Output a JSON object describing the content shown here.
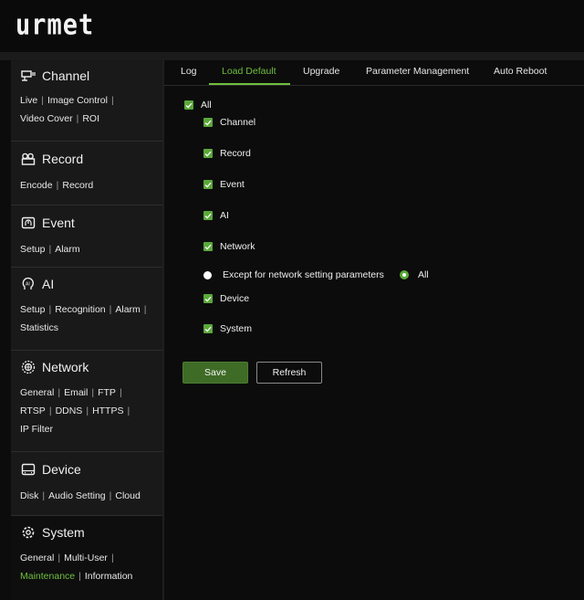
{
  "header": {
    "logo_text": "urmet"
  },
  "sidebar": {
    "sections": [
      {
        "title": "Channel",
        "icon": "channel-icon",
        "links": [
          [
            "Live",
            "Image Control"
          ],
          [
            "Video Cover",
            "ROI"
          ]
        ]
      },
      {
        "title": "Record",
        "icon": "record-icon",
        "links": [
          [
            "Encode",
            "Record"
          ]
        ]
      },
      {
        "title": "Event",
        "icon": "event-icon",
        "links": [
          [
            "Setup",
            "Alarm"
          ]
        ]
      },
      {
        "title": "AI",
        "icon": "ai-icon",
        "links": [
          [
            "Setup",
            "Recognition",
            "Alarm"
          ],
          [
            "Statistics"
          ]
        ]
      },
      {
        "title": "Network",
        "icon": "network-icon",
        "links": [
          [
            "General",
            "Email",
            "FTP"
          ],
          [
            "RTSP",
            "DDNS",
            "HTTPS"
          ],
          [
            "IP Filter"
          ]
        ]
      },
      {
        "title": "Device",
        "icon": "device-icon",
        "links": [
          [
            "Disk",
            "Audio Setting",
            "Cloud"
          ]
        ]
      },
      {
        "title": "System",
        "icon": "system-icon",
        "links": [
          [
            "General",
            "Multi-User"
          ],
          [
            "Maintenance",
            "Information"
          ]
        ]
      }
    ],
    "selected_link": "Maintenance"
  },
  "tabs": [
    "Log",
    "Load Default",
    "Upgrade",
    "Parameter Management",
    "Auto Reboot"
  ],
  "active_tab": "Load Default",
  "options": {
    "all": "All",
    "channel": "Channel",
    "record": "Record",
    "event": "Event",
    "ai": "AI",
    "network": "Network",
    "except_network": "Except for network setting parameters",
    "network_all": "All",
    "device": "Device",
    "system": "System"
  },
  "buttons": {
    "save": "Save",
    "refresh": "Refresh"
  },
  "colors": {
    "accent": "#6fbf3f",
    "checkbox": "#5aa83a",
    "save_bg": "#3e6b26",
    "sidebar_bg": "#191919",
    "page_bg": "#0c0c0c"
  }
}
